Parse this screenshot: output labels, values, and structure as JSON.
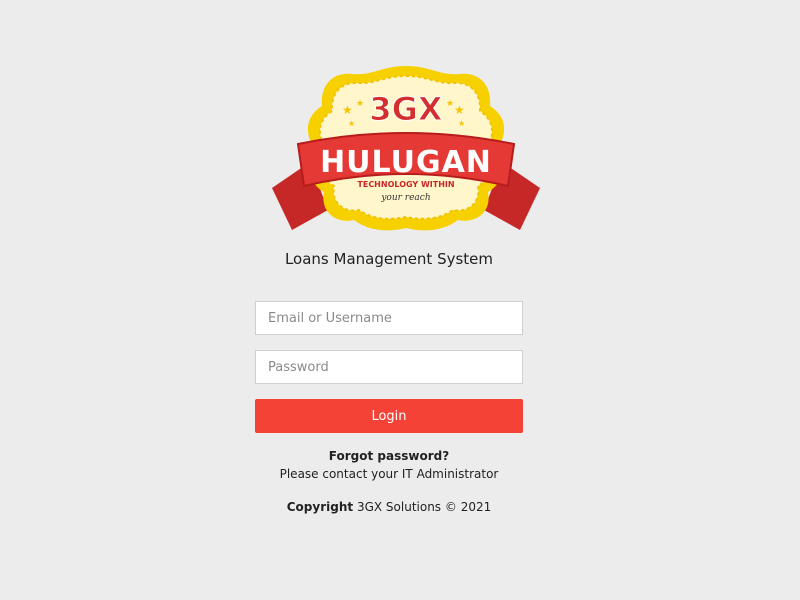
{
  "logo": {
    "brand_top": "3GX",
    "brand_main": "HULUGAN",
    "tagline_1": "TECHNOLOGY WITHIN",
    "tagline_2": "your reach",
    "colors": {
      "badge_yellow": "#f7d000",
      "badge_cream": "#fff6cc",
      "ribbon_red": "#e53935",
      "ribbon_dark": "#b71c1c",
      "letter_red": "#d32f2f"
    }
  },
  "header": {
    "system_title": "Loans Management System"
  },
  "form": {
    "email_placeholder": "Email or Username",
    "email_value": "",
    "password_placeholder": "Password",
    "password_value": "",
    "login_label": "Login"
  },
  "help": {
    "forgot_label": "Forgot password?",
    "contact_text": "Please contact your IT Administrator"
  },
  "footer": {
    "copyright_label": "Copyright",
    "copyright_text": "3GX Solutions © 2021"
  },
  "colors": {
    "background": "#ececec",
    "primary_button": "#f44336"
  }
}
